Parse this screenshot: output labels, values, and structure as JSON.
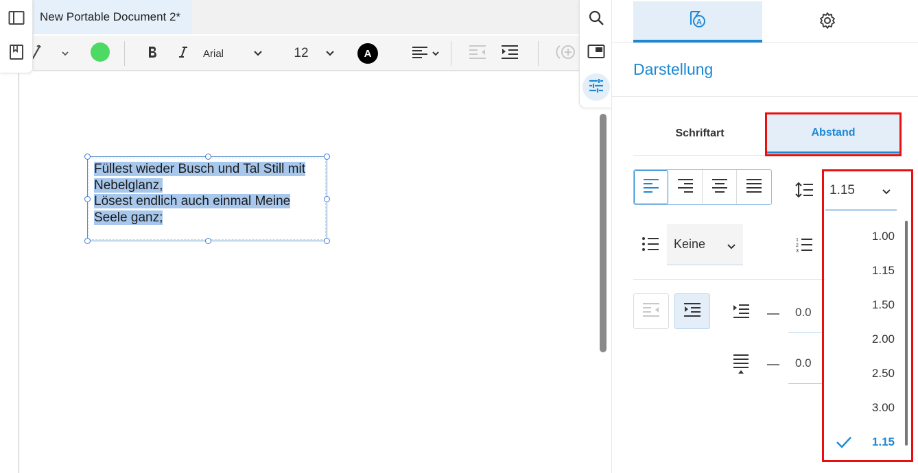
{
  "document": {
    "tab_title": "New Portable Document 2*",
    "textbox_lines": [
      "Füllest wieder Busch und Tal Still mit",
      "Nebelglanz,",
      "Lösest endlich auch einmal Meine",
      "Seele ganz;"
    ]
  },
  "toolbar": {
    "font_family": "Arial",
    "font_size": "12",
    "text_color_glyph": "A",
    "highlight_color": "#4cd964"
  },
  "panel": {
    "title": "Darstellung",
    "subtabs": {
      "font": "Schriftart",
      "spacing": "Abstand"
    },
    "line_spacing_value": "1.15",
    "list_style_value": "Keine",
    "indent_value": "0.0",
    "spacing_value": "0.0"
  },
  "dropdown": {
    "options": [
      "1.00",
      "1.15",
      "1.50",
      "2.00",
      "2.50",
      "3.00",
      "1.15"
    ],
    "selected_index": 6
  },
  "colors": {
    "accent": "#1c88d4",
    "highlight_box": "#ea0e0e",
    "selection": "#a7c8ec"
  }
}
